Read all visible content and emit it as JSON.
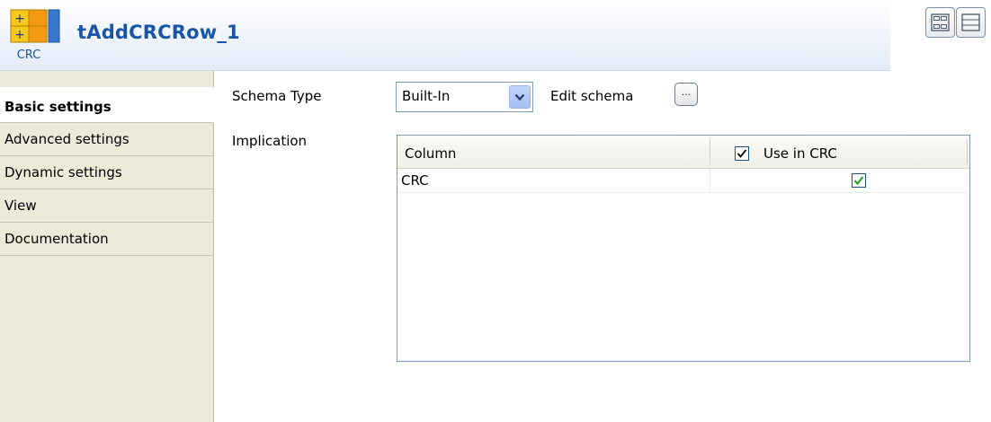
{
  "header": {
    "component_title": "tAddCRCRow_1",
    "icon_label": "CRC",
    "icon_name": "crc-component-icon",
    "view_icons": [
      "table-layout-icon",
      "list-layout-icon"
    ]
  },
  "tabs": [
    {
      "label": "Basic settings",
      "active": true
    },
    {
      "label": "Advanced settings",
      "active": false
    },
    {
      "label": "Dynamic settings",
      "active": false
    },
    {
      "label": "View",
      "active": false
    },
    {
      "label": "Documentation",
      "active": false
    }
  ],
  "form": {
    "schema_type_label": "Schema Type",
    "schema_type_value": "Built-In",
    "edit_schema_label": "Edit schema",
    "edit_schema_button": "...",
    "implication_label": "Implication"
  },
  "table": {
    "columns": [
      "Column",
      "Use in CRC"
    ],
    "header_checkbox_checked": true,
    "rows": [
      {
        "column": "CRC",
        "use_in_crc": true
      }
    ]
  },
  "colors": {
    "title": "#1a55a8",
    "tab_bg": "#ece9d8",
    "check_green": "#21a121"
  }
}
